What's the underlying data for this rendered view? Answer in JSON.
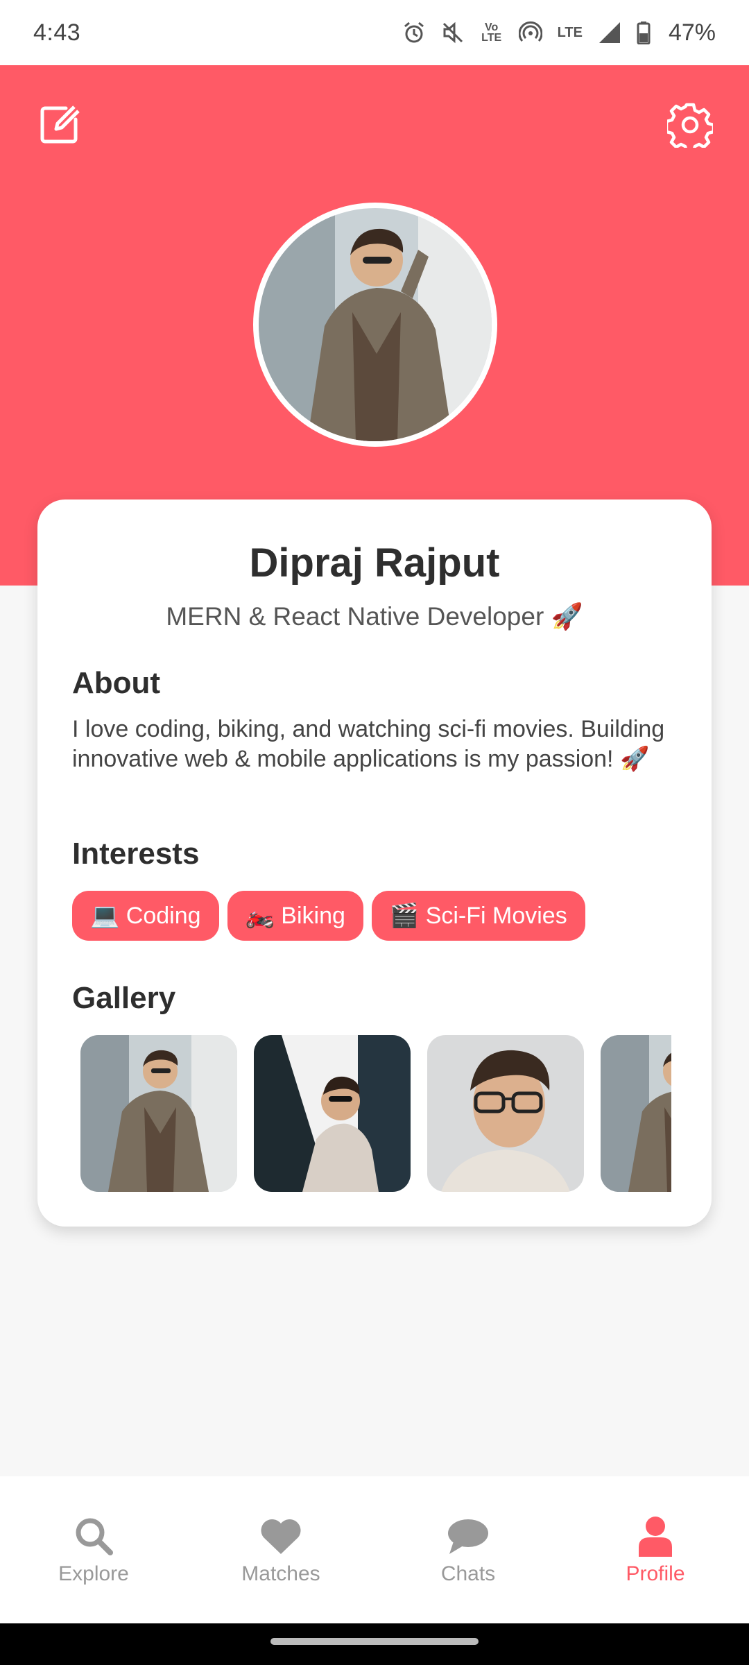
{
  "status_bar": {
    "time": "4:43",
    "battery_percent": "47%",
    "volte_label": "Vo LTE",
    "lte_label": "LTE",
    "icons": [
      "alarm-icon",
      "mute-icon",
      "volte-icon",
      "hotspot-icon",
      "lte-icon",
      "signal-icon",
      "battery-icon"
    ]
  },
  "header": {
    "color": "#ff5a66",
    "edit_icon": "edit-icon",
    "settings_icon": "gear-icon"
  },
  "profile": {
    "name": "Dipraj Rajput",
    "title": "MERN & React Native Developer 🚀"
  },
  "about": {
    "heading": "About",
    "text": "I love coding, biking, and watching sci-fi movies. Building innovative web & mobile applications is my passion! 🚀"
  },
  "interests": {
    "heading": "Interests",
    "items": [
      "💻 Coding",
      "🏍️ Biking",
      "🎬 Sci-Fi Movies"
    ]
  },
  "gallery": {
    "heading": "Gallery",
    "photo_count_visible": 4
  },
  "nav": {
    "items": [
      {
        "label": "Explore",
        "icon": "search-icon",
        "active": false
      },
      {
        "label": "Matches",
        "icon": "heart-icon",
        "active": false
      },
      {
        "label": "Chats",
        "icon": "chat-icon",
        "active": false
      },
      {
        "label": "Profile",
        "icon": "person-icon",
        "active": true
      }
    ]
  },
  "colors": {
    "accent": "#ff5a66",
    "inactive": "#999999",
    "text_dark": "#2e2e2e"
  }
}
